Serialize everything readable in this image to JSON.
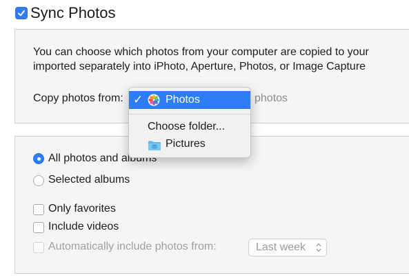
{
  "header": {
    "sync_checked": true,
    "title": "Sync Photos"
  },
  "source_box": {
    "description_line1": "You can choose which photos from your computer are copied to your",
    "description_line2": "imported separately into iPhoto, Aperture, Photos, or Image Capture",
    "copy_label": "Copy photos from:",
    "copy_suffix": "photos"
  },
  "dropdown_menu": {
    "selected": {
      "check": "✓",
      "label": "Photos",
      "icon": "photos-app-icon"
    },
    "items": [
      {
        "label": "Choose folder..."
      },
      {
        "label": "Pictures",
        "icon": "folder-icon"
      }
    ]
  },
  "options_box": {
    "radios": [
      {
        "label": "All photos and albums",
        "selected": true
      },
      {
        "label": "Selected albums",
        "selected": false
      }
    ],
    "checkboxes": [
      {
        "label": "Only favorites",
        "checked": false,
        "enabled": true
      },
      {
        "label": "Include videos",
        "checked": false,
        "enabled": true
      },
      {
        "label": "Automatically include photos from:",
        "checked": false,
        "enabled": false
      }
    ],
    "period_select": {
      "value": "Last week"
    }
  },
  "colors": {
    "accent": "#2f7df6",
    "box_bg": "#f5f5f5",
    "disabled_text": "#a0a0a0"
  }
}
